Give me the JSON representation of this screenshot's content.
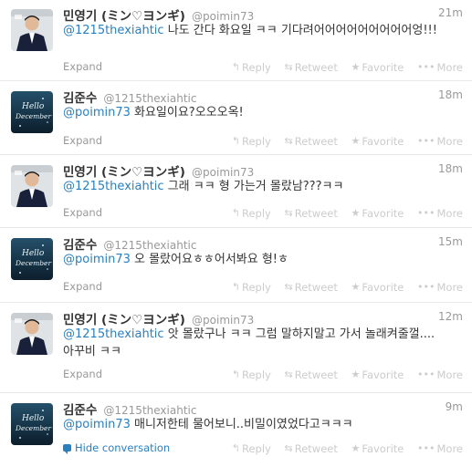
{
  "tweets": [
    {
      "name": "민영기 (ミン♡ヨンギ)",
      "handle": "@poimin73",
      "time": "21m",
      "mention": "@1215thexiahtic",
      "text": " 나도 간다 화요일 ㅋㅋ 기다려어어어어어어어어어엉!!!",
      "footer": "Expand",
      "avatar": "min-avatar"
    },
    {
      "name": "김준수",
      "handle": "@1215thexiahtic",
      "time": "18m",
      "mention": "@poimin73",
      "text": " 화요일이요?오오오옥!",
      "footer": "Expand",
      "avatar": "kim-avatar"
    },
    {
      "name": "민영기 (ミン♡ヨンギ)",
      "handle": "@poimin73",
      "time": "18m",
      "mention": "@1215thexiahtic",
      "text": " 그래 ㅋㅋ 형 가는거 몰랐남???ㅋㅋ",
      "footer": "Expand",
      "avatar": "min-avatar"
    },
    {
      "name": "김준수",
      "handle": "@1215thexiahtic",
      "time": "15m",
      "mention": "@poimin73",
      "text": " 오 몰랐어요ㅎㅎ어서봐요 형!ㅎ",
      "footer": "Expand",
      "avatar": "kim-avatar"
    },
    {
      "name": "민영기 (ミン♡ヨンギ)",
      "handle": "@poimin73",
      "time": "12m",
      "mention": "@1215thexiahtic",
      "text": " 앗 몰랐구나 ㅋㅋ  그럼 말하지말고 가서 놀래켜줄껄.... 아꾸비 ㅋㅋ",
      "footer": "Expand",
      "avatar": "min-avatar"
    },
    {
      "name": "김준수",
      "handle": "@1215thexiahtic",
      "time": "9m",
      "mention": "@poimin73",
      "text": " 매니저한테 물어보니..비밀이였었다고ㅋㅋㅋ",
      "footer": "Hide conversation",
      "avatar": "kim-avatar"
    }
  ],
  "actions": {
    "reply": "Reply",
    "retweet": "Retweet",
    "favorite": "Favorite",
    "more": "More"
  },
  "avatar_texts": {
    "kim_line1": "Hello",
    "kim_line2": "December"
  },
  "colors": {
    "link": "#2a7fbf",
    "muted": "#999999",
    "action": "#cccccc"
  }
}
